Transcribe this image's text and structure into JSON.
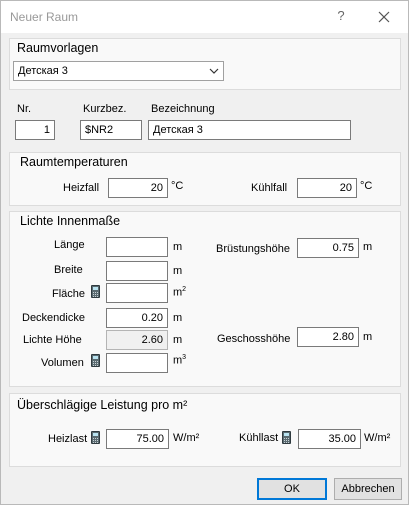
{
  "window": {
    "title": "Neuer Raum",
    "help": "?"
  },
  "raumvorlagen": {
    "title": "Raumvorlagen",
    "selected": "Детская 3"
  },
  "ident": {
    "nr_label": "Nr.",
    "nr_value": "1",
    "kurz_label": "Kurzbez.",
    "kurz_value": "$NR2",
    "bez_label": "Bezeichnung",
    "bez_value": "Детская 3"
  },
  "temps": {
    "title": "Raumtemperaturen",
    "heiz_label": "Heizfall",
    "heiz_value": "20",
    "heiz_unit": "°C",
    "kuehl_label": "Kühlfall",
    "kuehl_value": "20",
    "kuehl_unit": "°C"
  },
  "masse": {
    "title": "Lichte Innenmaße",
    "laenge_label": "Länge",
    "laenge_value": "",
    "laenge_unit": "m",
    "breite_label": "Breite",
    "breite_value": "",
    "breite_unit": "m",
    "flaeche_label": "Fläche",
    "flaeche_value": "",
    "flaeche_unit": "m",
    "flaeche_sup": "2",
    "decke_label": "Deckendicke",
    "decke_value": "0.20",
    "decke_unit": "m",
    "lichte_label": "Lichte Höhe",
    "lichte_value": "2.60",
    "lichte_unit": "m",
    "volumen_label": "Volumen",
    "volumen_value": "",
    "volumen_unit": "m",
    "volumen_sup": "3",
    "bruest_label": "Brüstungshöhe",
    "bruest_value": "0.75",
    "bruest_unit": "m",
    "geschoss_label": "Geschosshöhe",
    "geschoss_value": "2.80",
    "geschoss_unit": "m"
  },
  "leistung": {
    "title": "Überschlägige Leistung pro m²",
    "heiz_label": "Heizlast",
    "heiz_value": "75.00",
    "heiz_unit": "W/m²",
    "kuehl_label": "Kühllast",
    "kuehl_value": "35.00",
    "kuehl_unit": "W/m²"
  },
  "buttons": {
    "ok": "OK",
    "cancel": "Abbrechen"
  }
}
